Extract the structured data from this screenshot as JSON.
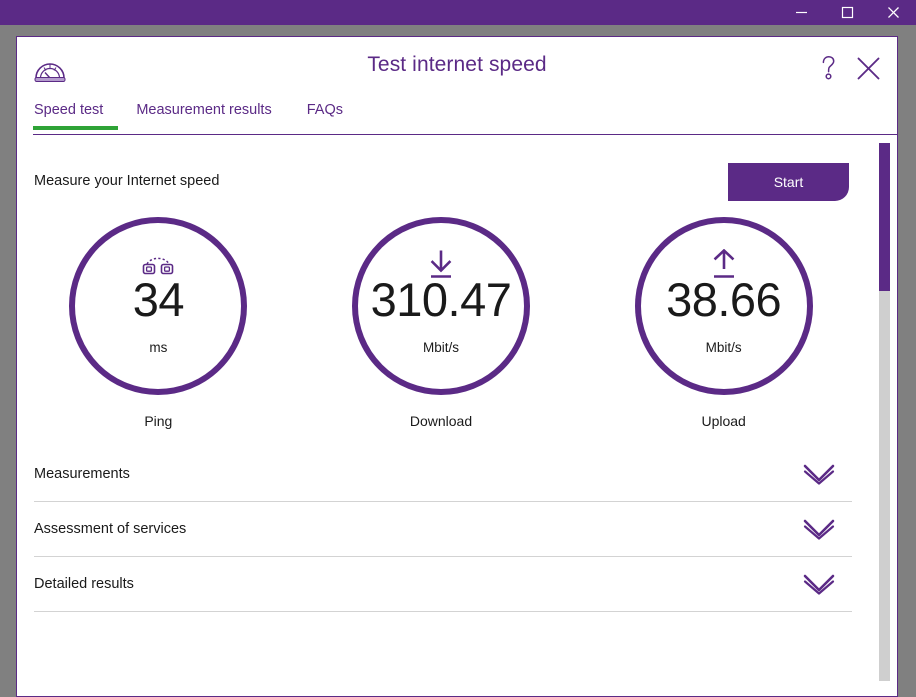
{
  "window": {
    "controls": [
      {
        "name": "minimize",
        "glyph": "minimize-icon",
        "label": "Minimize"
      },
      {
        "name": "maximize",
        "glyph": "maximize-icon",
        "label": "Maximize"
      },
      {
        "name": "close",
        "glyph": "close-icon",
        "label": "Close"
      }
    ],
    "titlebar_color": "#5b2a86",
    "frame_color": "#808080"
  },
  "app": {
    "title": "Test internet speed",
    "logo_icon": "speedometer-icon",
    "help_icon": "question-mark-icon",
    "close_icon": "close-icon",
    "accent_color": "#5b2a86",
    "active_tab_color": "#2ea336"
  },
  "tabs": [
    {
      "label": "Speed test",
      "active": true
    },
    {
      "label": "Measurement results",
      "active": false
    },
    {
      "label": "FAQs",
      "active": false
    }
  ],
  "measure": {
    "label": "Measure your Internet speed",
    "start_label": "Start"
  },
  "gauges": [
    {
      "caption": "Ping",
      "value": "34",
      "unit": "ms",
      "icon": "ping-latency-icon"
    },
    {
      "caption": "Download",
      "value": "310.47",
      "unit": "Mbit/s",
      "icon": "download-arrow-icon"
    },
    {
      "caption": "Upload",
      "value": "38.66",
      "unit": "Mbit/s",
      "icon": "upload-arrow-icon"
    }
  ],
  "accordions": [
    {
      "label": "Measurements",
      "icon": "chevron-down-icon"
    },
    {
      "label": "Assessment of services",
      "icon": "chevron-down-icon"
    },
    {
      "label": "Detailed results",
      "icon": "chevron-down-icon"
    }
  ]
}
